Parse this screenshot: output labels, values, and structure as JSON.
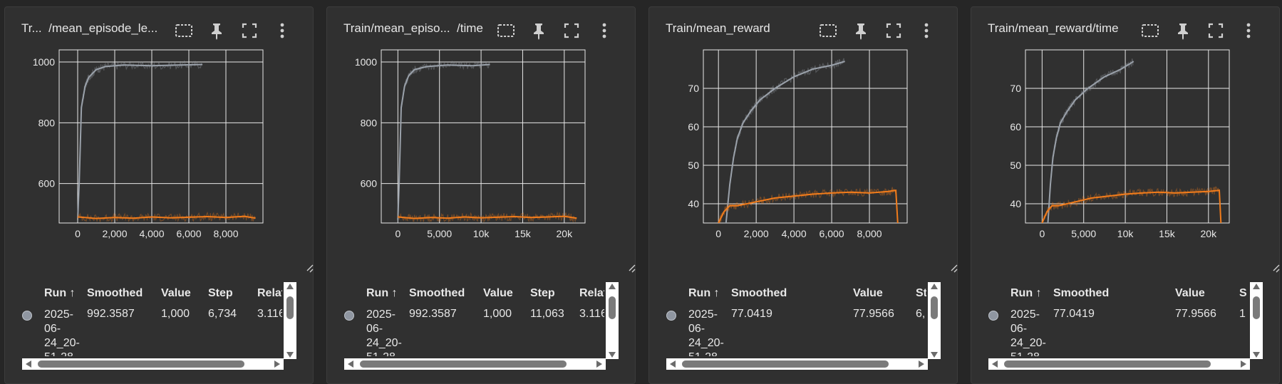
{
  "colors": {
    "gray_series": "#9aa1aa",
    "orange_series": "#f27c1b",
    "grid": "#e8e8e8",
    "panel_bg": "#303030"
  },
  "icons": [
    "fit-domain-icon",
    "pin-icon",
    "fullscreen-icon",
    "more-vert-icon"
  ],
  "panels": [
    {
      "title": "Tr...  /mean_episode_le...",
      "table": {
        "headers": [
          "Run ↑",
          "Smoothed",
          "Value",
          "Step",
          "Relat"
        ],
        "row": {
          "run": "2025-\n06-\n24_20-\n51-28",
          "smoothed": "992.3587",
          "value": "1,000",
          "step": "6,734",
          "relat": "3.116"
        }
      }
    },
    {
      "title": "Train/mean_episo...  /time",
      "table": {
        "headers": [
          "Run ↑",
          "Smoothed",
          "Value",
          "Step",
          "Relat"
        ],
        "row": {
          "run": "2025-\n06-\n24_20-\n51-28",
          "smoothed": "992.3587",
          "value": "1,000",
          "step": "11,063",
          "relat": "3.116"
        }
      }
    },
    {
      "title": "Train/mean_reward",
      "table": {
        "headers": [
          "Run ↑",
          "Smoothed",
          "Value",
          "St"
        ],
        "row": {
          "run": "2025-\n06-\n24_20-\n51-28",
          "smoothed": "77.0419",
          "value": "77.9566",
          "step": "6,"
        }
      }
    },
    {
      "title": "Train/mean_reward/time",
      "table": {
        "headers": [
          "Run ↑",
          "Smoothed",
          "Value",
          "S"
        ],
        "row": {
          "run": "2025-\n06-\n24_20-\n51-28",
          "smoothed": "77.0419",
          "value": "77.9566",
          "step": "1"
        }
      }
    }
  ],
  "chart_data": [
    {
      "type": "line",
      "title": "Tr...  /mean_episode_le...",
      "xlim": [
        -1000,
        10000
      ],
      "ylim": [
        470,
        1040
      ],
      "xticks": [
        0,
        2000,
        4000,
        6000,
        8000
      ],
      "xtick_labels": [
        "0",
        "2,000",
        "4,000",
        "6,000",
        "8,000"
      ],
      "yticks": [
        600,
        800,
        1000
      ],
      "ytick_labels": [
        "600",
        "800",
        "1000"
      ],
      "series": [
        {
          "color": "#9aa1aa",
          "x": [
            0,
            80,
            200,
            400,
            600,
            1000,
            1500,
            2500,
            4000,
            5500,
            6734
          ],
          "y": [
            480,
            600,
            850,
            920,
            950,
            975,
            985,
            990,
            988,
            990,
            992
          ]
        },
        {
          "color": "#f27c1b",
          "x": [
            0,
            1000,
            2000,
            3000,
            4000,
            5000,
            6000,
            7000,
            8000,
            9000,
            9600
          ],
          "y": [
            490,
            485,
            488,
            486,
            490,
            487,
            489,
            491,
            488,
            492,
            486
          ]
        }
      ]
    },
    {
      "type": "line",
      "title": "Train/mean_episo...  /time",
      "xlim": [
        -2000,
        22500
      ],
      "ylim": [
        470,
        1040
      ],
      "xticks": [
        0,
        5000,
        10000,
        15000,
        20000
      ],
      "xtick_labels": [
        "0",
        "5,000",
        "10k",
        "15k",
        "20k"
      ],
      "yticks": [
        600,
        800,
        1000
      ],
      "ytick_labels": [
        "600",
        "800",
        "1000"
      ],
      "series": [
        {
          "color": "#9aa1aa",
          "x": [
            0,
            150,
            400,
            800,
            1300,
            2000,
            3500,
            6000,
            9000,
            11063
          ],
          "y": [
            480,
            600,
            850,
            920,
            955,
            975,
            985,
            990,
            988,
            992
          ]
        },
        {
          "color": "#f27c1b",
          "x": [
            0,
            2000,
            4000,
            6000,
            8000,
            10000,
            12000,
            14000,
            16000,
            18000,
            20000,
            21500
          ],
          "y": [
            490,
            485,
            488,
            486,
            490,
            487,
            489,
            491,
            488,
            490,
            492,
            486
          ]
        }
      ]
    },
    {
      "type": "line",
      "title": "Train/mean_reward",
      "xlim": [
        -800,
        10000
      ],
      "ylim": [
        35,
        80
      ],
      "xticks": [
        0,
        2000,
        4000,
        6000,
        8000
      ],
      "xtick_labels": [
        "0",
        "2,000",
        "4,000",
        "6,000",
        "8,000"
      ],
      "yticks": [
        40,
        50,
        60,
        70
      ],
      "ytick_labels": [
        "40",
        "50",
        "60",
        "70"
      ],
      "series": [
        {
          "color": "#9aa1aa",
          "x": [
            400,
            600,
            800,
            1000,
            1300,
            1700,
            2200,
            3000,
            4000,
            5000,
            6000,
            6700
          ],
          "y": [
            35,
            45,
            52,
            57,
            61,
            64,
            67,
            70,
            73,
            75,
            76,
            77
          ]
        },
        {
          "color": "#f27c1b",
          "x": [
            0,
            300,
            600,
            1000,
            2000,
            3000,
            4000,
            5000,
            6000,
            7000,
            8000,
            9000,
            9400,
            9500
          ],
          "y": [
            35,
            38,
            39.5,
            39.5,
            40.5,
            41.5,
            42,
            42.5,
            42.8,
            43,
            42.8,
            43.2,
            43.5,
            35
          ]
        }
      ]
    },
    {
      "type": "line",
      "title": "Train/mean_reward/time",
      "xlim": [
        -2000,
        22500
      ],
      "ylim": [
        35,
        80
      ],
      "xticks": [
        0,
        5000,
        10000,
        15000,
        20000
      ],
      "xtick_labels": [
        "0",
        "5,000",
        "10k",
        "15k",
        "20k"
      ],
      "yticks": [
        40,
        50,
        60,
        70
      ],
      "ytick_labels": [
        "40",
        "50",
        "60",
        "70"
      ],
      "series": [
        {
          "color": "#9aa1aa",
          "x": [
            700,
            1000,
            1300,
            1700,
            2200,
            3000,
            4000,
            5500,
            7500,
            9500,
            11000
          ],
          "y": [
            35,
            45,
            52,
            57,
            61,
            64,
            67,
            70,
            73,
            75,
            77
          ]
        },
        {
          "color": "#f27c1b",
          "x": [
            0,
            600,
            1200,
            2000,
            4000,
            6000,
            8000,
            10000,
            12000,
            14000,
            16000,
            18000,
            20000,
            21300,
            21500
          ],
          "y": [
            35,
            38,
            39.5,
            39.5,
            40.5,
            41.5,
            42,
            42.5,
            42.8,
            43,
            42.8,
            43,
            43.2,
            43.5,
            35
          ]
        }
      ]
    }
  ]
}
